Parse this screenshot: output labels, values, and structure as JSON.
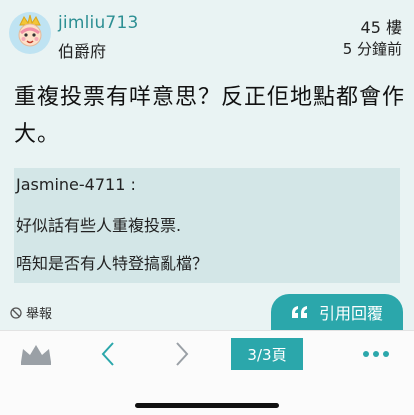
{
  "post": {
    "username": "jimliu713",
    "user_title": "伯爵府",
    "floor": "45 樓",
    "time": "5 分鐘前",
    "content": "重複投票有咩意思？反正佢地點都會作大。",
    "quote": {
      "author": "Jasmine-4711 :",
      "line1": "好似話有些人重複投票.",
      "line2": "唔知是否有人特登搞亂檔？"
    },
    "report_label": "舉報",
    "reply_label": "引用回覆"
  },
  "toolbar": {
    "page_indicator": "3/3頁"
  },
  "colors": {
    "accent": "#2ba7ab",
    "post_background": "#e9f3f3",
    "quote_background": "#d3e6e7",
    "username": "#2d8f93"
  },
  "icons": {
    "avatar": "cartoon-baby-avatar-icon",
    "report": "no-entry-icon",
    "reply": "quote-icon",
    "crown": "crown-icon",
    "prev": "chevron-left-icon",
    "next": "chevron-right-icon",
    "more": "more-dots-icon"
  }
}
